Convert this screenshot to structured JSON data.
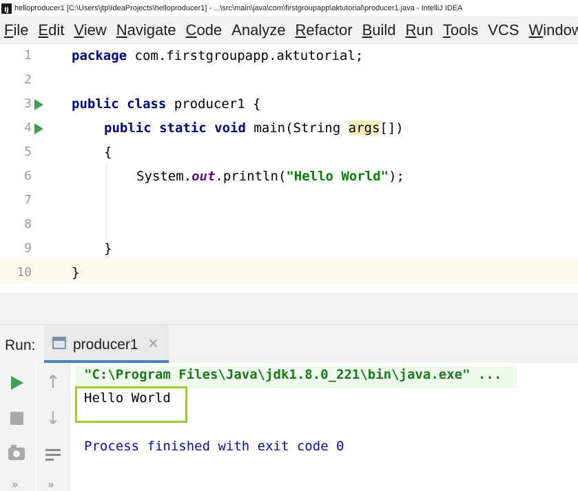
{
  "window": {
    "title": "helloproducer1 [C:\\Users\\jtp\\IdeaProjects\\helloproducer1] - ...\\src\\main\\java\\com\\firstgroupapp\\aktutorial\\producer1.java - IntelliJ IDEA",
    "app_icon": "intellij-icon",
    "app_icon_text": "IJ"
  },
  "menu": {
    "items": [
      {
        "mnemonic": "F",
        "rest": "ile"
      },
      {
        "mnemonic": "E",
        "rest": "dit"
      },
      {
        "mnemonic": "V",
        "rest": "iew"
      },
      {
        "mnemonic": "N",
        "rest": "avigate"
      },
      {
        "mnemonic": "C",
        "rest": "ode"
      },
      {
        "mnemonic": "",
        "rest": "Analyze"
      },
      {
        "mnemonic": "R",
        "rest": "efactor"
      },
      {
        "mnemonic": "B",
        "rest": "uild"
      },
      {
        "mnemonic": "R",
        "rest": "un"
      },
      {
        "mnemonic": "T",
        "rest": "ools"
      },
      {
        "mnemonic": "",
        "rest": "VCS"
      },
      {
        "mnemonic": "W",
        "rest": "indow"
      }
    ]
  },
  "editor": {
    "line_numbers": [
      "1",
      "2",
      "3",
      "4",
      "5",
      "6",
      "7",
      "8",
      "9",
      "10"
    ],
    "line1": {
      "kw": "package",
      "rest": " com.firstgroupapp.aktutorial;"
    },
    "line3": {
      "kw": "public class",
      "rest": " producer1 {"
    },
    "line4": {
      "kw": "public static void",
      "mid": " main(String ",
      "param": "args",
      "end": "[])"
    },
    "line5": "{",
    "line6": {
      "pre": "System.",
      "field": "out",
      "mid": ".println(",
      "str": "\"Hello World\"",
      "end": ");"
    },
    "line9": "}",
    "line10": "}",
    "run_gutter_icon": "run-gutter-icon"
  },
  "run_panel": {
    "label": "Run:",
    "tab_label": "producer1",
    "tab_close": "×",
    "console": {
      "command": "\"C:\\Program Files\\Java\\jdk1.8.0_221\\bin\\java.exe\" ...",
      "output": "Hello World",
      "exit_message": "Process finished with exit code 0"
    },
    "toolbar": {
      "more_symbol": "»",
      "up_arrow": "↑",
      "down_arrow": "↓"
    }
  },
  "colors": {
    "keyword": "#000080",
    "string": "#008000",
    "field": "#660e7a",
    "run_green": "#3ea152",
    "highlight_box": "#9bd22a",
    "exit_text": "#0b0bb3"
  }
}
